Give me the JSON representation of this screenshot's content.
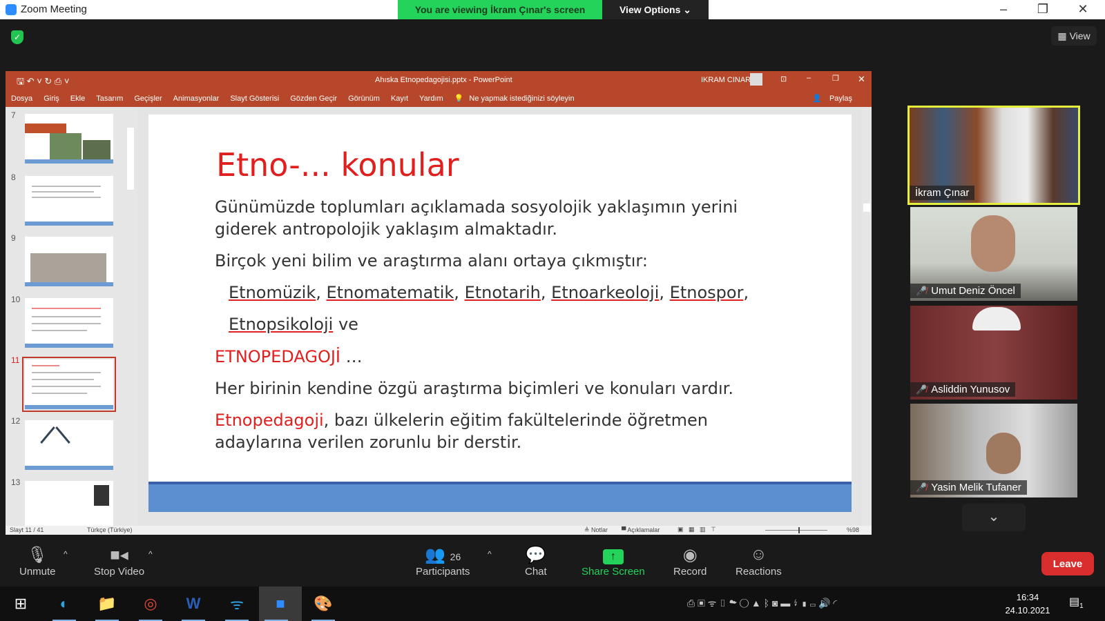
{
  "zoom": {
    "window_title": "Zoom Meeting",
    "banner_text": "You are viewing İkram Çınar's screen",
    "view_options_label": "View Options ⌄",
    "view_label": "View",
    "colors": {
      "banner": "#23d35a",
      "leave": "#d92e2e",
      "share": "#23d35a",
      "active_speaker": "#e6f03c"
    }
  },
  "ppt": {
    "title": "Ahıska Etnopedagojisi.pptx  -  PowerPoint",
    "user": "IKRAM CINAR",
    "share": "Paylaş",
    "tabs": [
      "Dosya",
      "Giriş",
      "Ekle",
      "Tasarım",
      "Geçişler",
      "Animasyonlar",
      "Slayt Gösterisi",
      "Gözden Geçir",
      "Görünüm",
      "Kayıt",
      "Yardım"
    ],
    "tell_me": "Ne yapmak istediğinizi söyleyin",
    "thumbnails": [
      "7",
      "8",
      "9",
      "10",
      "11",
      "12",
      "13"
    ],
    "selected_slide": "11",
    "status": {
      "slide": "Slayt 11 / 41",
      "language": "Türkçe (Türkiye)",
      "notes": "Notlar",
      "comments": "Açıklamalar",
      "zoom": "%98"
    },
    "color": "#b7472a"
  },
  "slide": {
    "title": "Etno-... konular",
    "p1": "Günümüzde toplumları açıklamada sosyolojik yaklaşımın yerini giderek antropolojik yaklaşım almaktadır.",
    "p2": "Birçok yeni bilim ve araştırma alanı ortaya çıkmıştır:",
    "fields": [
      "Etnomüzik",
      "Etnomatematik",
      "Etnotarih",
      "Etnoarkeoloji",
      "Etnospor",
      "Etnopsikoloji"
    ],
    "fields_end": "ve",
    "p3_red": "ETNOPEDAGOJİ",
    "p3_rest": " …",
    "p4": "Her birinin kendine özgü araştırma biçimleri ve konuları vardır.",
    "p5_red": "Etnopedagoji",
    "p5_rest": ", bazı ülkelerin eğitim fakültelerinde öğretmen adaylarına verilen zorunlu bir derstir."
  },
  "participants": [
    {
      "name": "İkram Çınar",
      "muted": false,
      "active": true
    },
    {
      "name": "Umut Deniz Öncel",
      "muted": true
    },
    {
      "name": "Asliddin Yunusov",
      "muted": true
    },
    {
      "name": "Yasin Melik Tufaner",
      "muted": true
    }
  ],
  "toolbar": {
    "unmute": "Unmute",
    "stop_video": "Stop Video",
    "participants": "Participants",
    "participants_count": "26",
    "chat": "Chat",
    "share_screen": "Share Screen",
    "record": "Record",
    "reactions": "Reactions",
    "leave": "Leave"
  },
  "taskbar": {
    "time": "16:34",
    "date": "24.10.2021",
    "notifications": "1"
  }
}
